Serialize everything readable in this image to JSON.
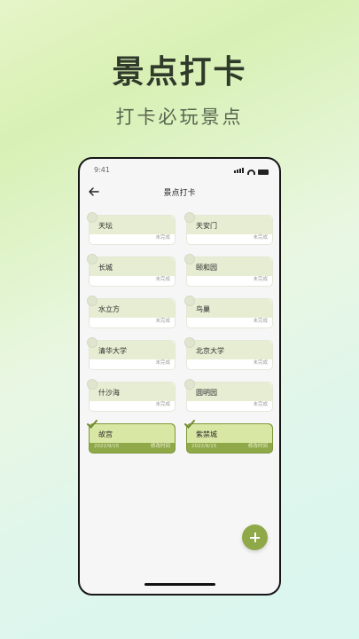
{
  "headline": "景点打卡",
  "subline": "打卡必玩景点",
  "status": {
    "time": "9:41"
  },
  "screen": {
    "title": "景点打卡"
  },
  "colors": {
    "accent": "#8fa848",
    "card_header": "#e7edd2",
    "done_header": "#d8e8a4"
  },
  "spots": [
    {
      "name": "天坛",
      "status": "未完成",
      "done": false
    },
    {
      "name": "天安门",
      "status": "未完成",
      "done": false
    },
    {
      "name": "长城",
      "status": "未完成",
      "done": false
    },
    {
      "name": "颐和园",
      "status": "未完成",
      "done": false
    },
    {
      "name": "水立方",
      "status": "未完成",
      "done": false
    },
    {
      "name": "鸟巢",
      "status": "未完成",
      "done": false
    },
    {
      "name": "清华大学",
      "status": "未完成",
      "done": false
    },
    {
      "name": "北京大学",
      "status": "未完成",
      "done": false
    },
    {
      "name": "什沙海",
      "status": "未完成",
      "done": false
    },
    {
      "name": "圆明园",
      "status": "未完成",
      "done": false
    },
    {
      "name": "故宫",
      "status": "修改时间",
      "date": "2022/9/15",
      "done": true
    },
    {
      "name": "紫禁城",
      "status": "修改时间",
      "date": "2022/9/15",
      "done": true
    }
  ]
}
